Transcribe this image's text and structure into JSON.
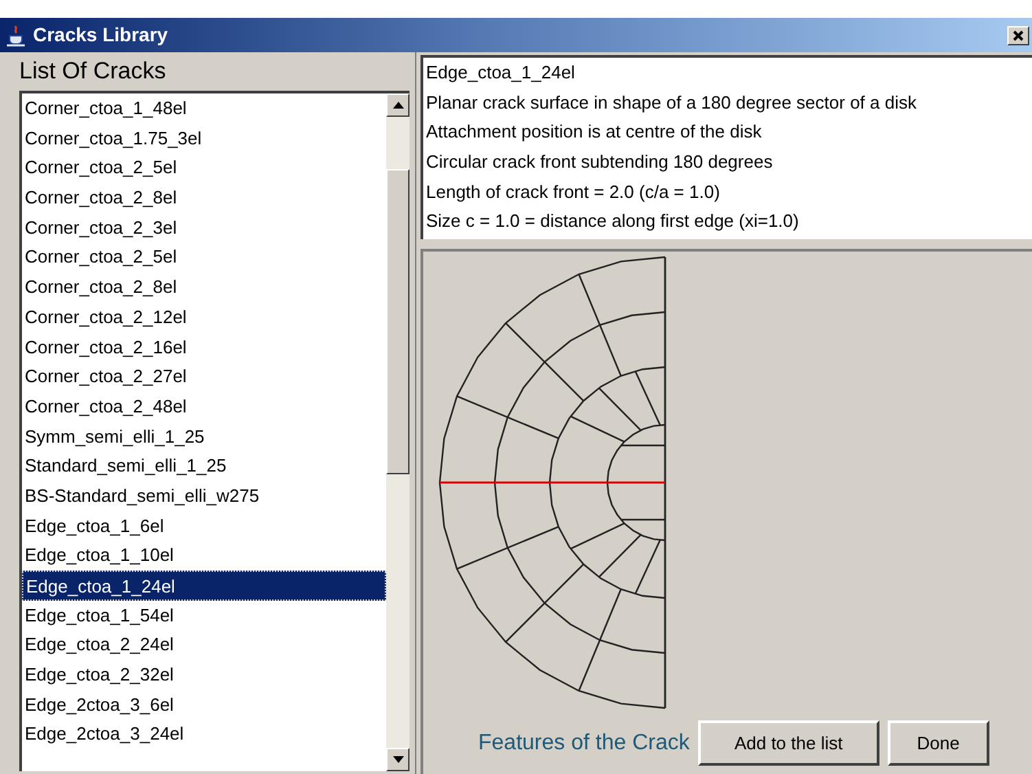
{
  "window": {
    "title": "Cracks Library"
  },
  "list": {
    "heading": "List Of Cracks",
    "items": [
      {
        "label": "Corner_ctoa_1_48el",
        "selected": false
      },
      {
        "label": "Corner_ctoa_1.75_3el",
        "selected": false
      },
      {
        "label": "Corner_ctoa_2_5el",
        "selected": false
      },
      {
        "label": "Corner_ctoa_2_8el",
        "selected": false
      },
      {
        "label": "Corner_ctoa_2_3el",
        "selected": false
      },
      {
        "label": "Corner_ctoa_2_5el",
        "selected": false
      },
      {
        "label": "Corner_ctoa_2_8el",
        "selected": false
      },
      {
        "label": "Corner_ctoa_2_12el",
        "selected": false
      },
      {
        "label": "Corner_ctoa_2_16el",
        "selected": false
      },
      {
        "label": "Corner_ctoa_2_27el",
        "selected": false
      },
      {
        "label": "Corner_ctoa_2_48el",
        "selected": false
      },
      {
        "label": "Symm_semi_elli_1_25",
        "selected": false
      },
      {
        "label": "Standard_semi_elli_1_25",
        "selected": false
      },
      {
        "label": "BS-Standard_semi_elli_w275",
        "selected": false
      },
      {
        "label": "Edge_ctoa_1_6el",
        "selected": false
      },
      {
        "label": "Edge_ctoa_1_10el",
        "selected": false
      },
      {
        "label": "Edge_ctoa_1_24el",
        "selected": true
      },
      {
        "label": "Edge_ctoa_1_54el",
        "selected": false
      },
      {
        "label": "Edge_ctoa_2_24el",
        "selected": false
      },
      {
        "label": "Edge_ctoa_2_32el",
        "selected": false
      },
      {
        "label": "Edge_2ctoa_3_6el",
        "selected": false
      },
      {
        "label": "Edge_2ctoa_3_24el",
        "selected": false
      }
    ]
  },
  "details": [
    "Edge_ctoa_1_24el",
    "Planar crack surface in shape of a 180 degree sector of a disk",
    "Attachment position is at centre of the disk",
    "Circular crack front subtending 180 degrees",
    "Length of crack front = 2.0 (c/a = 1.0)",
    "Size c = 1.0 = distance along first edge (xi=1.0)"
  ],
  "footer": {
    "label": "Features of the Crack",
    "buttons": [
      "Add to the list",
      "Done"
    ]
  }
}
